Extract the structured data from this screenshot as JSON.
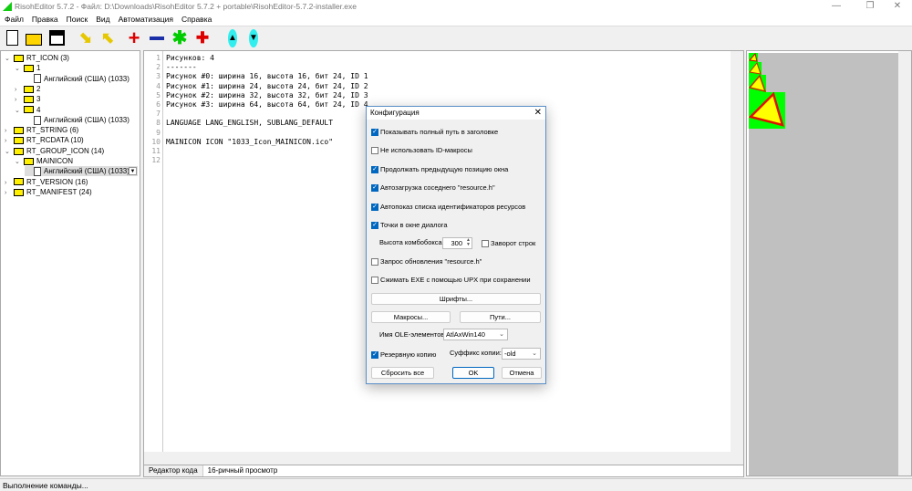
{
  "window": {
    "title": "RisohEditor 5.7.2 - Файл: D:\\Downloads\\RisohEditor 5.7.2 + portable\\RisohEditor-5.7.2-installer.exe"
  },
  "menu": [
    "Файл",
    "Правка",
    "Поиск",
    "Вид",
    "Автоматизация",
    "Справка"
  ],
  "toolbar": {
    "icons": [
      "new-file",
      "open-folder",
      "save",
      "arrow-down",
      "arrow-up",
      "add",
      "remove",
      "modify",
      "clone",
      "move-up",
      "move-down"
    ]
  },
  "tree": [
    {
      "label": "RT_ICON (3)",
      "level": 0,
      "expanded": true
    },
    {
      "label": "1",
      "level": 1,
      "expanded": true
    },
    {
      "label": "Английский (США) (1033)",
      "level": 2,
      "leaf": true
    },
    {
      "label": "2",
      "level": 1
    },
    {
      "label": "3",
      "level": 1
    },
    {
      "label": "4",
      "level": 1,
      "expanded": true
    },
    {
      "label": "Английский (США) (1033)",
      "level": 2,
      "leaf": true
    },
    {
      "label": "RT_STRING (6)",
      "level": 0
    },
    {
      "label": "RT_RCDATA (10)",
      "level": 0
    },
    {
      "label": "RT_GROUP_ICON (14)",
      "level": 0,
      "expanded": true
    },
    {
      "label": "MAINICON",
      "level": 1,
      "expanded": true
    },
    {
      "label": "Английский (США) (1033)",
      "level": 2,
      "leaf": true,
      "selected": true
    },
    {
      "label": "RT_VERSION (16)",
      "level": 0
    },
    {
      "label": "RT_MANIFEST (24)",
      "level": 0
    }
  ],
  "editor": {
    "lines": [
      "Рисунков: 4",
      "-------",
      "Рисунок #0: ширина 16, высота 16, бит 24, ID 1",
      "Рисунок #1: ширина 24, высота 24, бит 24, ID 2",
      "Рисунок #2: ширина 32, высота 32, бит 24, ID 3",
      "Рисунок #3: ширина 64, высота 64, бит 24, ID 4",
      "",
      "LANGUAGE LANG_ENGLISH, SUBLANG_DEFAULT",
      "",
      "MAINICON ICON \"1033_Icon_MAINICON.ico\"",
      "",
      ""
    ]
  },
  "tabs": [
    "Редактор кода",
    "16-ричный просмотр"
  ],
  "status": "Выполнение команды...",
  "dialog": {
    "title": "Конфигурация",
    "close": "✕",
    "checks": [
      {
        "label": "Показывать полный путь в заголовке",
        "checked": true
      },
      {
        "label": "Не использовать ID-макросы",
        "checked": false
      },
      {
        "label": "Продолжать предыдущую позицию окна",
        "checked": true
      },
      {
        "label": "Автозагрузка соседнего \"resource.h\"",
        "checked": true
      },
      {
        "label": "Автопоказ списка идентификаторов ресурсов",
        "checked": true
      },
      {
        "label": "Точки в окне диалога",
        "checked": true
      }
    ],
    "combo_height_label": "Высота комбобокса:",
    "combo_height_value": "300",
    "wrap": {
      "label": "Заворот строк",
      "checked": false
    },
    "checks2": [
      {
        "label": "Запрос обновления \"resource.h\"",
        "checked": false
      },
      {
        "label": "Сжимать EXE с помощью UPX при сохранении",
        "checked": false
      }
    ],
    "fonts_button": "Шрифты...",
    "macros_button": "Макросы...",
    "paths_button": "Пути...",
    "ole_label": "Имя OLE-элементов:",
    "ole_value": "AtlAxWin140",
    "backup": {
      "label": "Резервную копию",
      "checked": true
    },
    "suffix_label": "Суффикс копии:",
    "suffix_value": "-old",
    "reset_button": "Сбросить все",
    "ok_button": "OK",
    "cancel_button": "Отмена"
  }
}
